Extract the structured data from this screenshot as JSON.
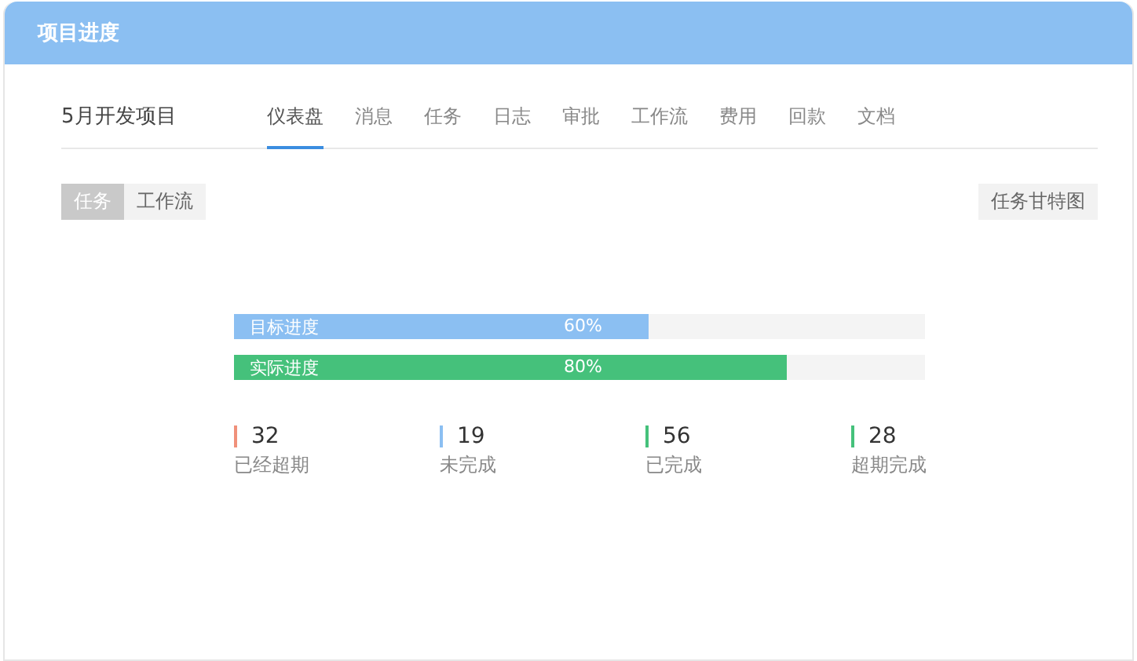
{
  "window": {
    "title": "项目进度"
  },
  "project": {
    "name": "5月开发项目"
  },
  "tabs": [
    {
      "label": "仪表盘",
      "selected": true
    },
    {
      "label": "消息",
      "selected": false
    },
    {
      "label": "任务",
      "selected": false
    },
    {
      "label": "日志",
      "selected": false
    },
    {
      "label": "审批",
      "selected": false
    },
    {
      "label": "工作流",
      "selected": false
    },
    {
      "label": "费用",
      "selected": false
    },
    {
      "label": "回款",
      "selected": false
    },
    {
      "label": "文档",
      "selected": false
    }
  ],
  "view_toggle": [
    {
      "label": "任务",
      "selected": true
    },
    {
      "label": "工作流",
      "selected": false
    }
  ],
  "gantt_button": "任务甘特图",
  "progress": [
    {
      "label": "目标进度",
      "value": "60%",
      "level": 0.6,
      "color": "#8bbff2"
    },
    {
      "label": "实际进度",
      "value": "80%",
      "level": 0.8,
      "color": "#45c17b"
    }
  ],
  "stats": [
    {
      "count": "32",
      "label": "已经超期",
      "color": "#f0907a"
    },
    {
      "count": "19",
      "label": "未完成",
      "color": "#8bbff2"
    },
    {
      "count": "56",
      "label": "已完成",
      "color": "#45c17b"
    },
    {
      "count": "28",
      "label": "超期完成",
      "color": "#45c17b"
    }
  ]
}
